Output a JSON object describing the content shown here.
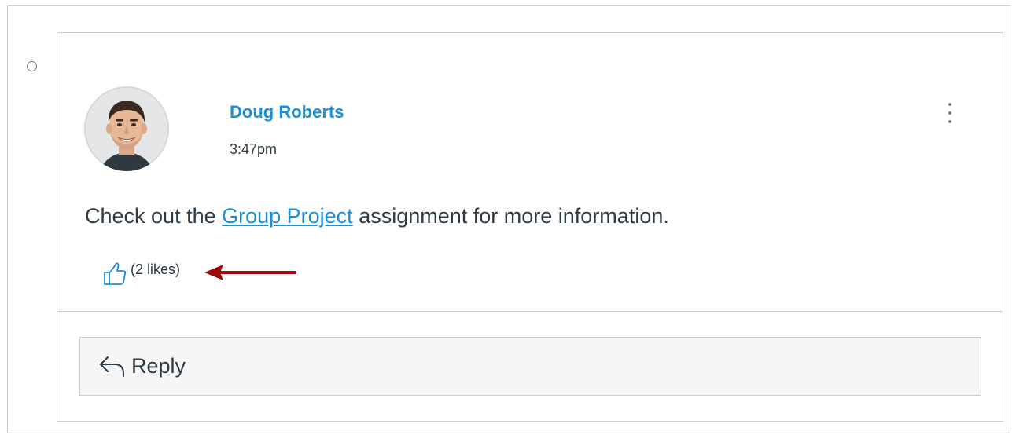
{
  "entry": {
    "author_name": "Doug Roberts",
    "timestamp": "3:47pm",
    "message": {
      "before_link": "Check out the ",
      "link_text": "Group Project",
      "after_link": " assignment for more information."
    },
    "likes_text": "(2 likes)",
    "reply_label": "Reply"
  },
  "icons": {
    "unread": "unread-circle-icon",
    "options": "kebab-menu-icon",
    "like": "thumbs-up-icon",
    "annotation": "red-arrow-icon",
    "reply": "reply-arrow-icon"
  },
  "colors": {
    "link": "#1a8ed8",
    "text": "#2d3b45",
    "border": "#c7cdd1",
    "annotation_arrow": "#9b0a0a",
    "reply_background": "#f5f5f5"
  }
}
